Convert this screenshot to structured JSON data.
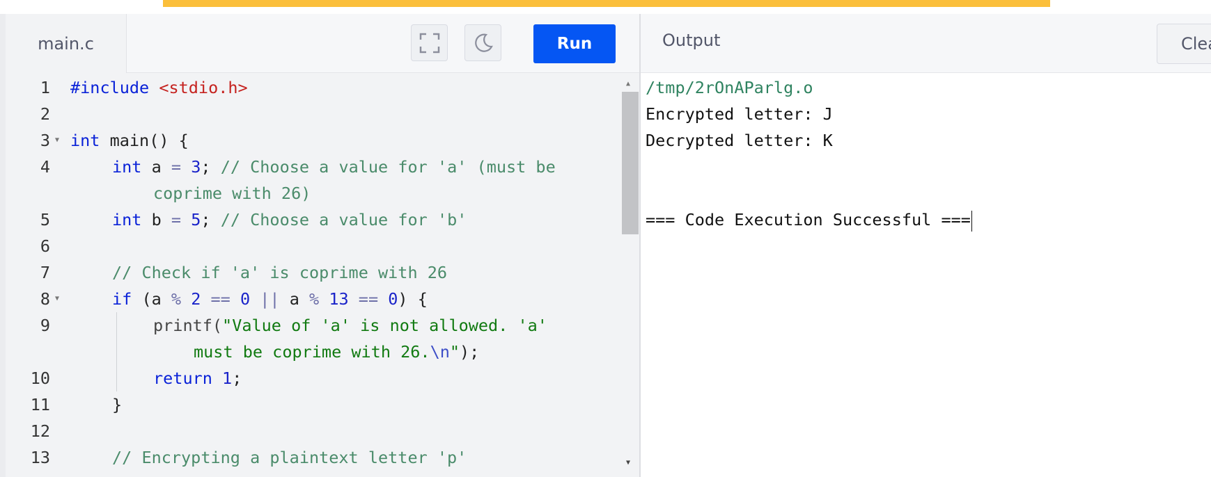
{
  "editor": {
    "file_tab": "main.c",
    "run_label": "Run",
    "icons": {
      "fullscreen": "fullscreen-icon",
      "theme": "moon-icon"
    },
    "line_numbers": [
      "1",
      "2",
      "3",
      "4",
      "",
      "5",
      "6",
      "7",
      "8",
      "9",
      "",
      "10",
      "11",
      "12",
      "13"
    ],
    "code": {
      "l1_kw": "#include",
      "l1_inc": "<stdio.h>",
      "l3_kw": "int",
      "l3_rest": " main() {",
      "l4_kw": "int",
      "l4_a": " a ",
      "l4_eq": "=",
      "l4_num": "3",
      "l4_semi": ";",
      "l4_cm": "// Choose a value for 'a' (must be",
      "l4_cm2": "coprime with 26)",
      "l5_kw": "int",
      "l5_b": " b ",
      "l5_eq": "=",
      "l5_num": "5",
      "l5_semi": ";",
      "l5_cm": "// Choose a value for 'b'",
      "l7_cm": "// Check if 'a' is coprime with 26",
      "l8_if": "if",
      "l8_p1": " (a ",
      "l8_mod1": "%",
      "l8_n2": "2",
      "l8_eq1": "==",
      "l8_n0a": "0",
      "l8_or": "||",
      "l8_a2": " a ",
      "l8_mod2": "%",
      "l8_n13": "13",
      "l8_eq2": "==",
      "l8_n0b": "0",
      "l8_end": ") {",
      "l9_fn": "printf(",
      "l9_str": "\"Value of 'a' is not allowed. 'a'",
      "l9_str2": "must be coprime with 26.",
      "l9_esc": "\\n",
      "l9_q": "\"",
      "l9_end": ");",
      "l10_kw": "return",
      "l10_num": "1",
      "l10_semi": ";",
      "l11": "}",
      "l13_cm": "// Encrypting a plaintext letter 'p'"
    }
  },
  "output": {
    "title": "Output",
    "clear_label": "Clear",
    "lines": [
      "/tmp/2rOnAParlg.o",
      "Encrypted letter: J",
      "Decrypted letter: K",
      "",
      "=== Code Execution Successful ==="
    ]
  },
  "colors": {
    "accent_bar": "#fbbf3b",
    "run_button": "#0556f3",
    "keyword": "#0a22d8",
    "comment": "#4a8b6a",
    "string": "#117a11",
    "include": "#c5221f"
  }
}
